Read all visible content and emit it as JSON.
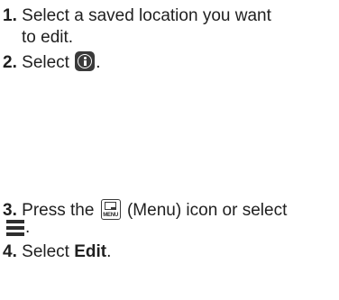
{
  "steps": [
    {
      "number": "1.",
      "line1": "Select a saved location you want",
      "line2": "to edit."
    },
    {
      "number": "2.",
      "prefix": "Select ",
      "suffix": "."
    },
    {
      "number": "3.",
      "prefix": "Press the ",
      "icon_label": "MENU",
      "suffix": " (Menu) icon or select",
      "line2_suffix": "."
    },
    {
      "number": "4.",
      "prefix": "Select ",
      "bold": "Edit",
      "suffix": "."
    }
  ],
  "icons": {
    "step2": "info-icon",
    "step3": "menu-button-icon",
    "step3_line2": "hamburger-menu-icon"
  }
}
